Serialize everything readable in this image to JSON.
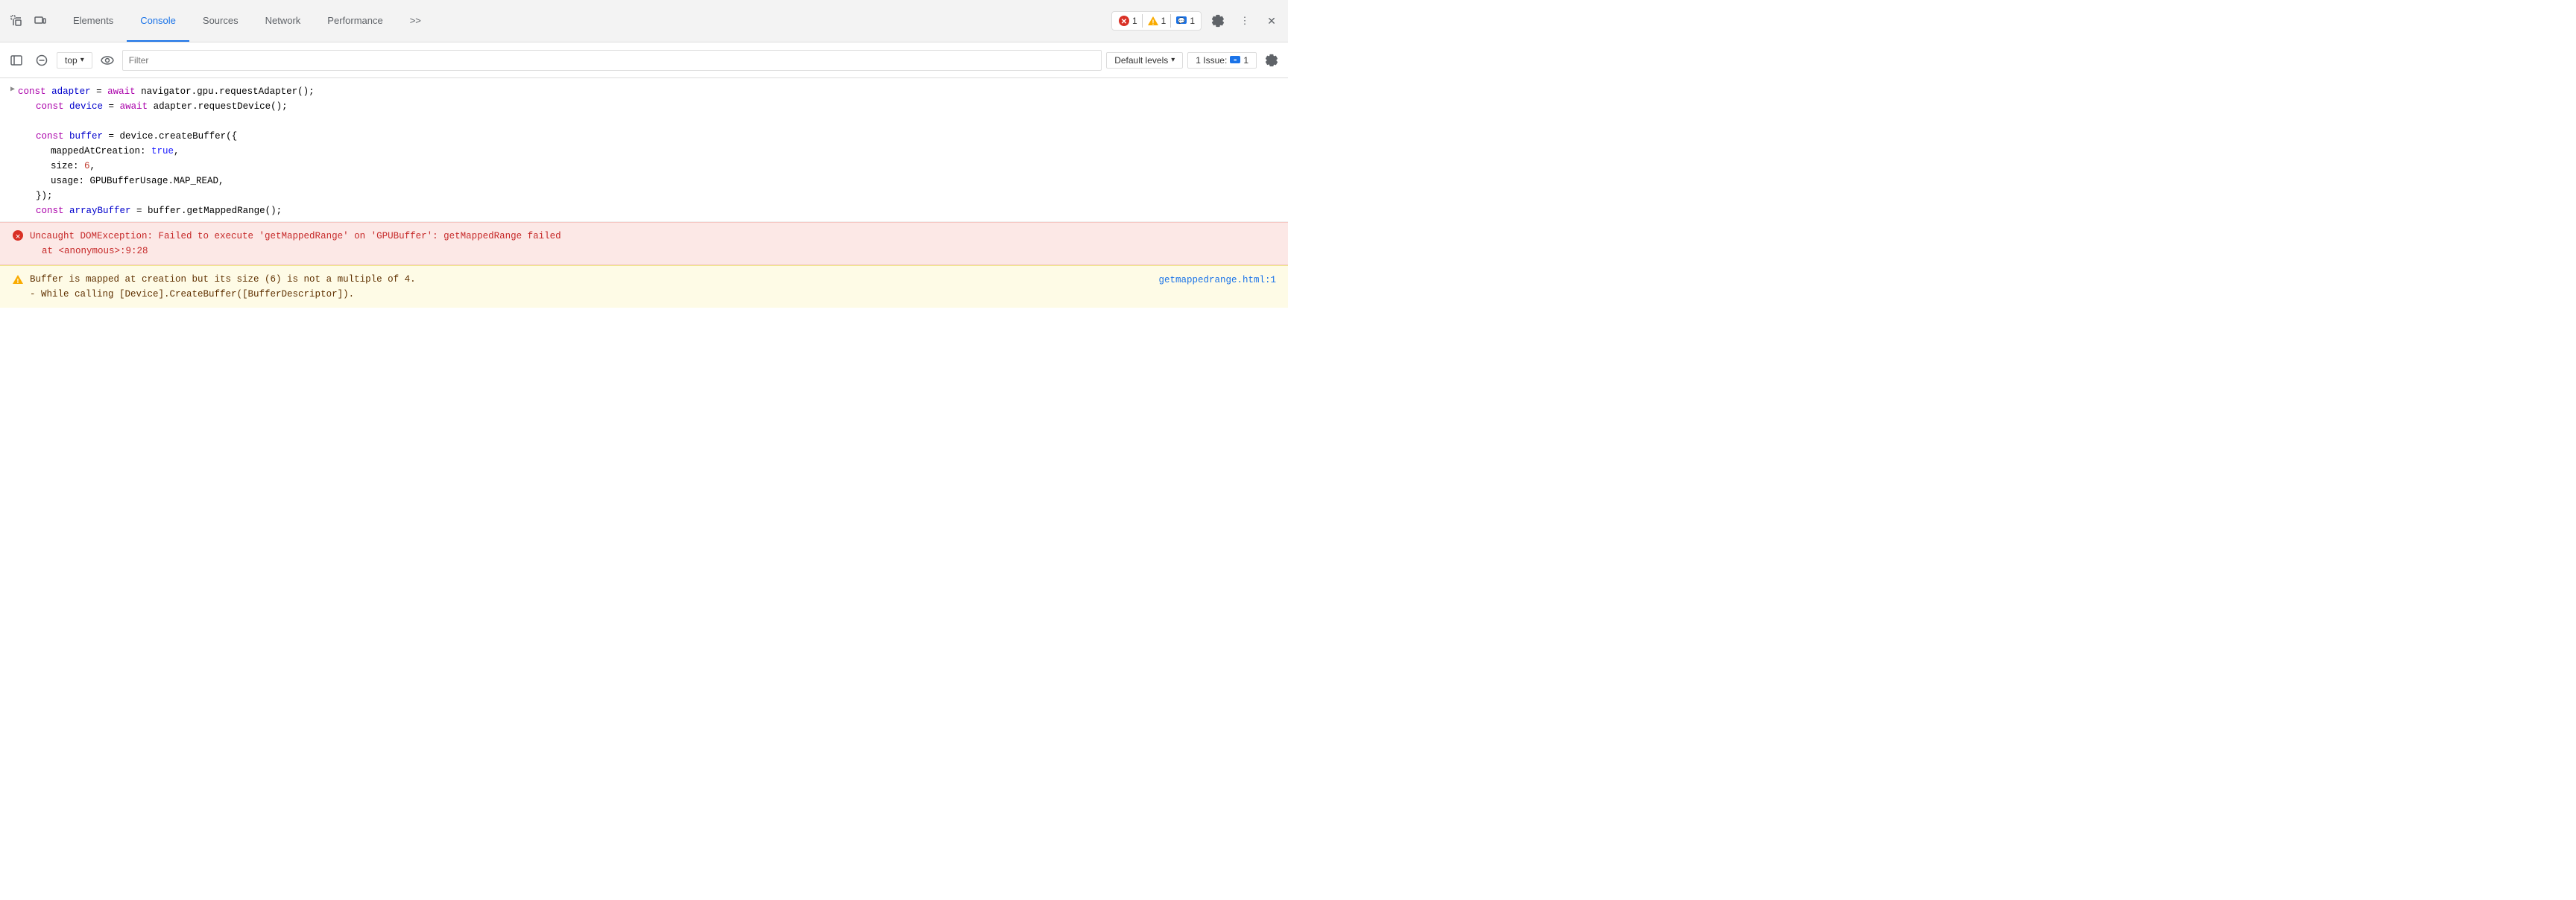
{
  "tabs": {
    "icon1_title": "Inspect element",
    "icon2_title": "Device toolbar",
    "elements": "Elements",
    "console": "Console",
    "sources": "Sources",
    "network": "Network",
    "performance": "Performance",
    "more": ">>"
  },
  "badges": {
    "errors": "1",
    "warnings": "1",
    "info": "1"
  },
  "second_toolbar": {
    "sidebar_btn_title": "Toggle sidebar",
    "clear_btn_title": "Clear console",
    "context_label": "top",
    "eye_title": "Live expressions",
    "filter_placeholder": "Filter",
    "levels_label": "Default levels",
    "issue_prefix": "1 Issue:",
    "issue_count": "1"
  },
  "code": {
    "line1": "const adapter = await navigator.gpu.requestAdapter();",
    "line2": "const device = await adapter.requestDevice();",
    "line3": "const buffer = device.createBuffer({",
    "line4": "  mappedAtCreation: true,",
    "line5": "  size: 6,",
    "line6": "  usage: GPUBufferUsage.MAP_READ,",
    "line7": "});",
    "line8": "const arrayBuffer = buffer.getMappedRange();"
  },
  "error": {
    "message": "Uncaught DOMException: Failed to execute 'getMappedRange' on 'GPUBuffer': getMappedRange failed",
    "location": "    at <anonymous>:9:28"
  },
  "warning": {
    "message": "Buffer is mapped at creation but its size (6) is not a multiple of 4.",
    "detail": " - While calling [Device].CreateBuffer([BufferDescriptor]).",
    "link_text": "getmappedrange.html:1"
  },
  "colors": {
    "error_red": "#d93025",
    "warn_yellow": "#f9ab00",
    "info_blue": "#1a73e8",
    "purple": "#aa00aa",
    "blue_code": "#0000cc",
    "teal": "#008080"
  }
}
